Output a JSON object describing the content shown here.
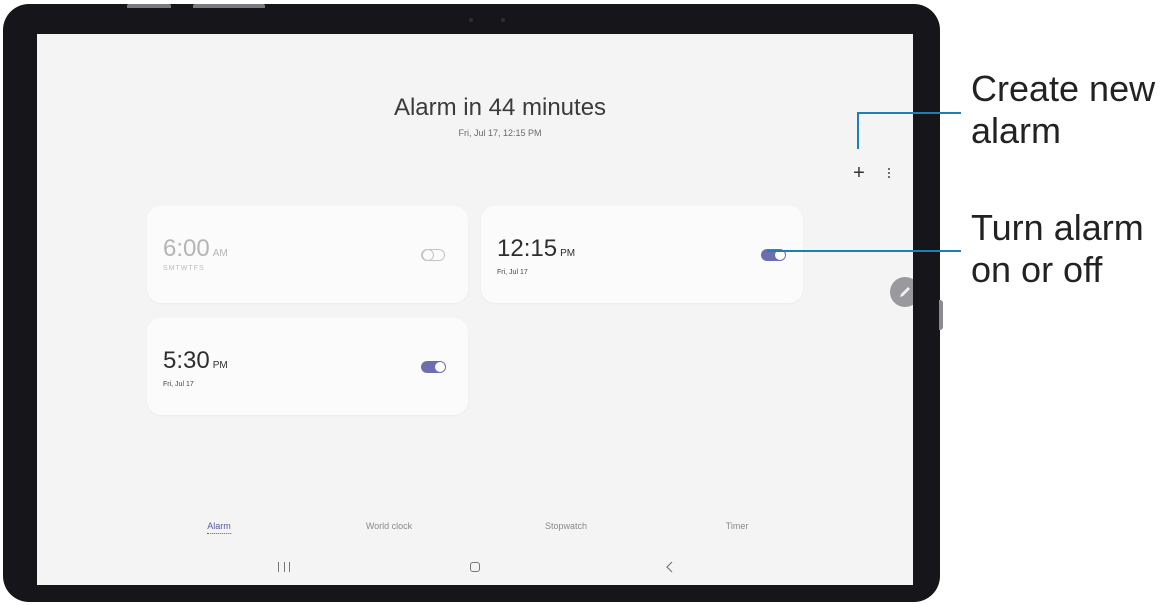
{
  "header": {
    "title": "Alarm in 44 minutes",
    "subtitle": "Fri, Jul 17, 12:15 PM"
  },
  "alarms": [
    {
      "time": "6:00",
      "ampm": "AM",
      "days": [
        "S",
        "M",
        "T",
        "W",
        "T",
        "F",
        "S"
      ],
      "enabled": false
    },
    {
      "time": "12:15",
      "ampm": "PM",
      "date": "Fri, Jul 17",
      "enabled": true
    },
    {
      "time": "5:30",
      "ampm": "PM",
      "date": "Fri, Jul 17",
      "enabled": true
    }
  ],
  "toolbar": {
    "add_icon": "plus-icon",
    "more_icon": "more-vertical-icon"
  },
  "edit_fab_icon": "pencil-icon",
  "tabs": [
    {
      "label": "Alarm",
      "active": true
    },
    {
      "label": "World clock",
      "active": false
    },
    {
      "label": "Stopwatch",
      "active": false
    },
    {
      "label": "Timer",
      "active": false
    }
  ],
  "nav_bar": {
    "recent_icon": "recent-apps-icon",
    "home_icon": "home-icon",
    "back_icon": "back-icon"
  },
  "callouts": {
    "create": "Create new\nalarm",
    "toggle": "Turn alarm\non or off"
  },
  "colors": {
    "accent": "#6d6eb0",
    "callout_line": "#1d7fb2",
    "screen_bg": "#f4f4f4",
    "card_bg": "#fbfbfb"
  }
}
